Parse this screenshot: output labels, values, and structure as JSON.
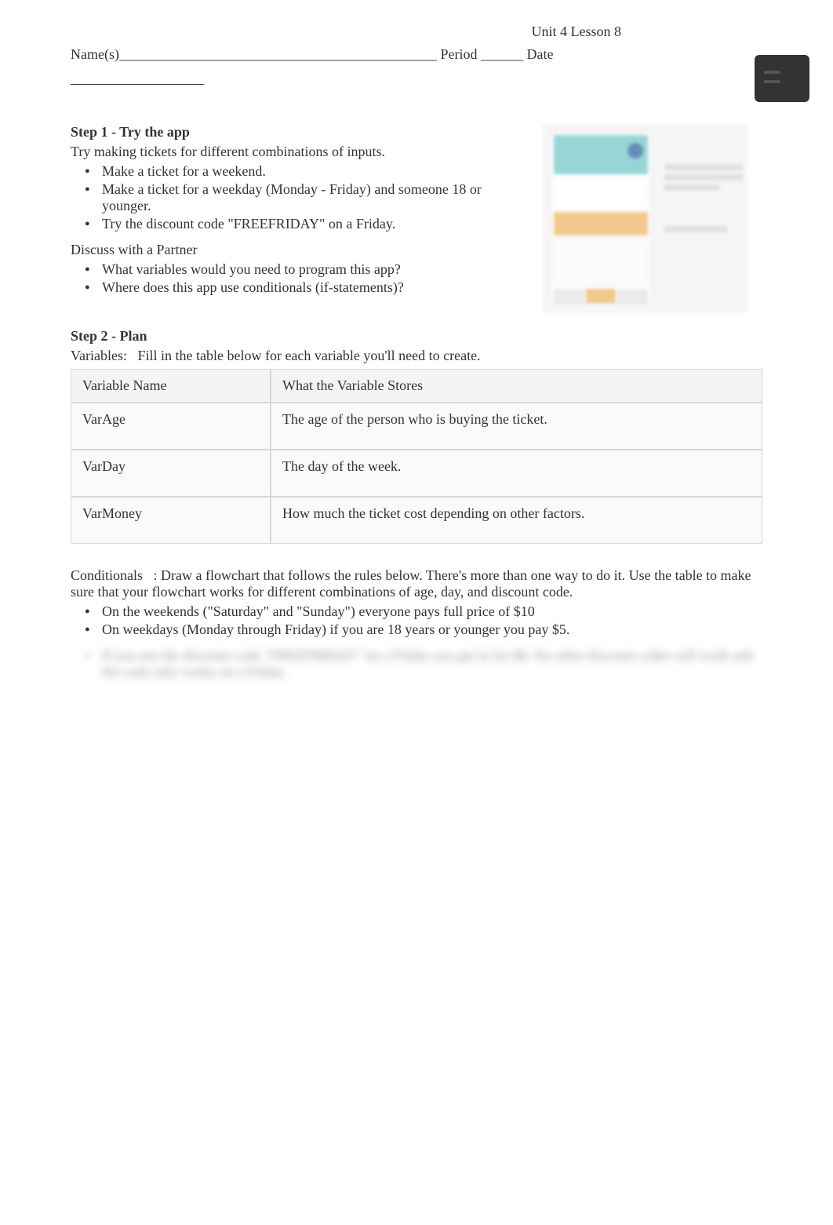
{
  "header": {
    "unit": "Unit 4 Lesson 8",
    "name_label": "Name(s)_____________________________________________",
    "period_label": " Period ______",
    "date_label": " Date"
  },
  "step1": {
    "title": "Step 1 - Try the app",
    "intro": "Try making tickets for different combinations of inputs.",
    "bullets": [
      "Make a ticket for a weekend.",
      "Make a ticket for a weekday (Monday - Friday) and someone 18 or younger.",
      "Try the discount code \"FREEFRIDAY\" on a Friday."
    ],
    "discuss_title": "Discuss with a Partner",
    "discuss_bullets": [
      "What variables would you need to program this app?",
      "Where does this app use conditionals (if-statements)?"
    ]
  },
  "step2": {
    "title": "Step 2 - Plan",
    "vars_label": "Variables:",
    "vars_instr": "Fill in the table below for each variable you'll need to create."
  },
  "table": {
    "head_name": "Variable Name",
    "head_desc": "What the Variable Stores",
    "rows": [
      {
        "name": "VarAge",
        "desc": "The age of the person who is buying the ticket."
      },
      {
        "name": "VarDay",
        "desc": "The day of the week."
      },
      {
        "name": "VarMoney",
        "desc": "How much the ticket cost depending on other factors."
      }
    ]
  },
  "conditionals": {
    "label": "Conditionals",
    "instr": ": Draw a flowchart that follows the rules below. There's more than one way to do it. Use the table to make sure that your flowchart works for different combinations of age, day, and discount code.",
    "bullets": [
      "On the weekends (\"Saturday\" and \"Sunday\") everyone pays full price of $10",
      "On weekdays (Monday through Friday) if you are 18 years or younger you pay $5."
    ],
    "blurred": "If you use the discount code \"FREEFRIDAY\" on a Friday you get in for $0. No other discount codes will work and the code only works on a Friday."
  }
}
